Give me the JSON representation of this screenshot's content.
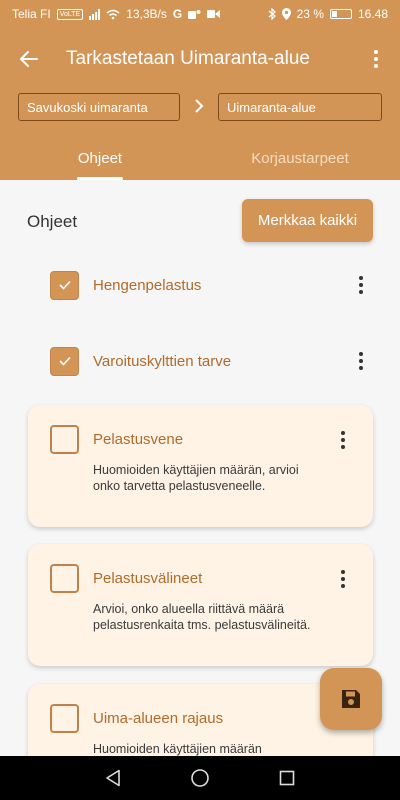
{
  "status": {
    "carrier": "Telia FI",
    "volte": "VoLTE",
    "speed": "13,3B/s",
    "icons": [
      "signal-icon",
      "wifi-icon",
      "google-icon",
      "teams-icon",
      "video-icon",
      "bluetooth-icon",
      "location-icon",
      "battery-icon"
    ],
    "battery": "23 %",
    "time": "16.48"
  },
  "appbar": {
    "title": "Tarkastetaan Uimaranta-alue",
    "breadcrumb": [
      "Savukoski uimaranta",
      "Uimaranta-alue"
    ]
  },
  "tabs": [
    {
      "label": "Ohjeet",
      "active": true
    },
    {
      "label": "Korjaustarpeet",
      "active": false
    }
  ],
  "main": {
    "section_title": "Ohjeet",
    "mark_all_label": "Merkkaa kaikki",
    "items": [
      {
        "label": "Hengenpelastus",
        "checked": true
      },
      {
        "label": "Varoituskylttien tarve",
        "checked": true
      },
      {
        "label": "Pelastusvene",
        "checked": false,
        "description": "Huomioiden käyttäjien määrän, arvioi onko tarvetta pelastusveneelle."
      },
      {
        "label": "Pelastusvälineet",
        "checked": false,
        "description": "Arvioi, onko alueella riittävä määrä pelastusrenkaita tms. pelastusvälineitä."
      },
      {
        "label": "Uima-alueen rajaus",
        "checked": false,
        "description": "Huomioiden käyttäjien määrän"
      }
    ]
  },
  "colors": {
    "accent": "#d39556",
    "label": "#b06b2c",
    "card": "#fff3e6"
  }
}
